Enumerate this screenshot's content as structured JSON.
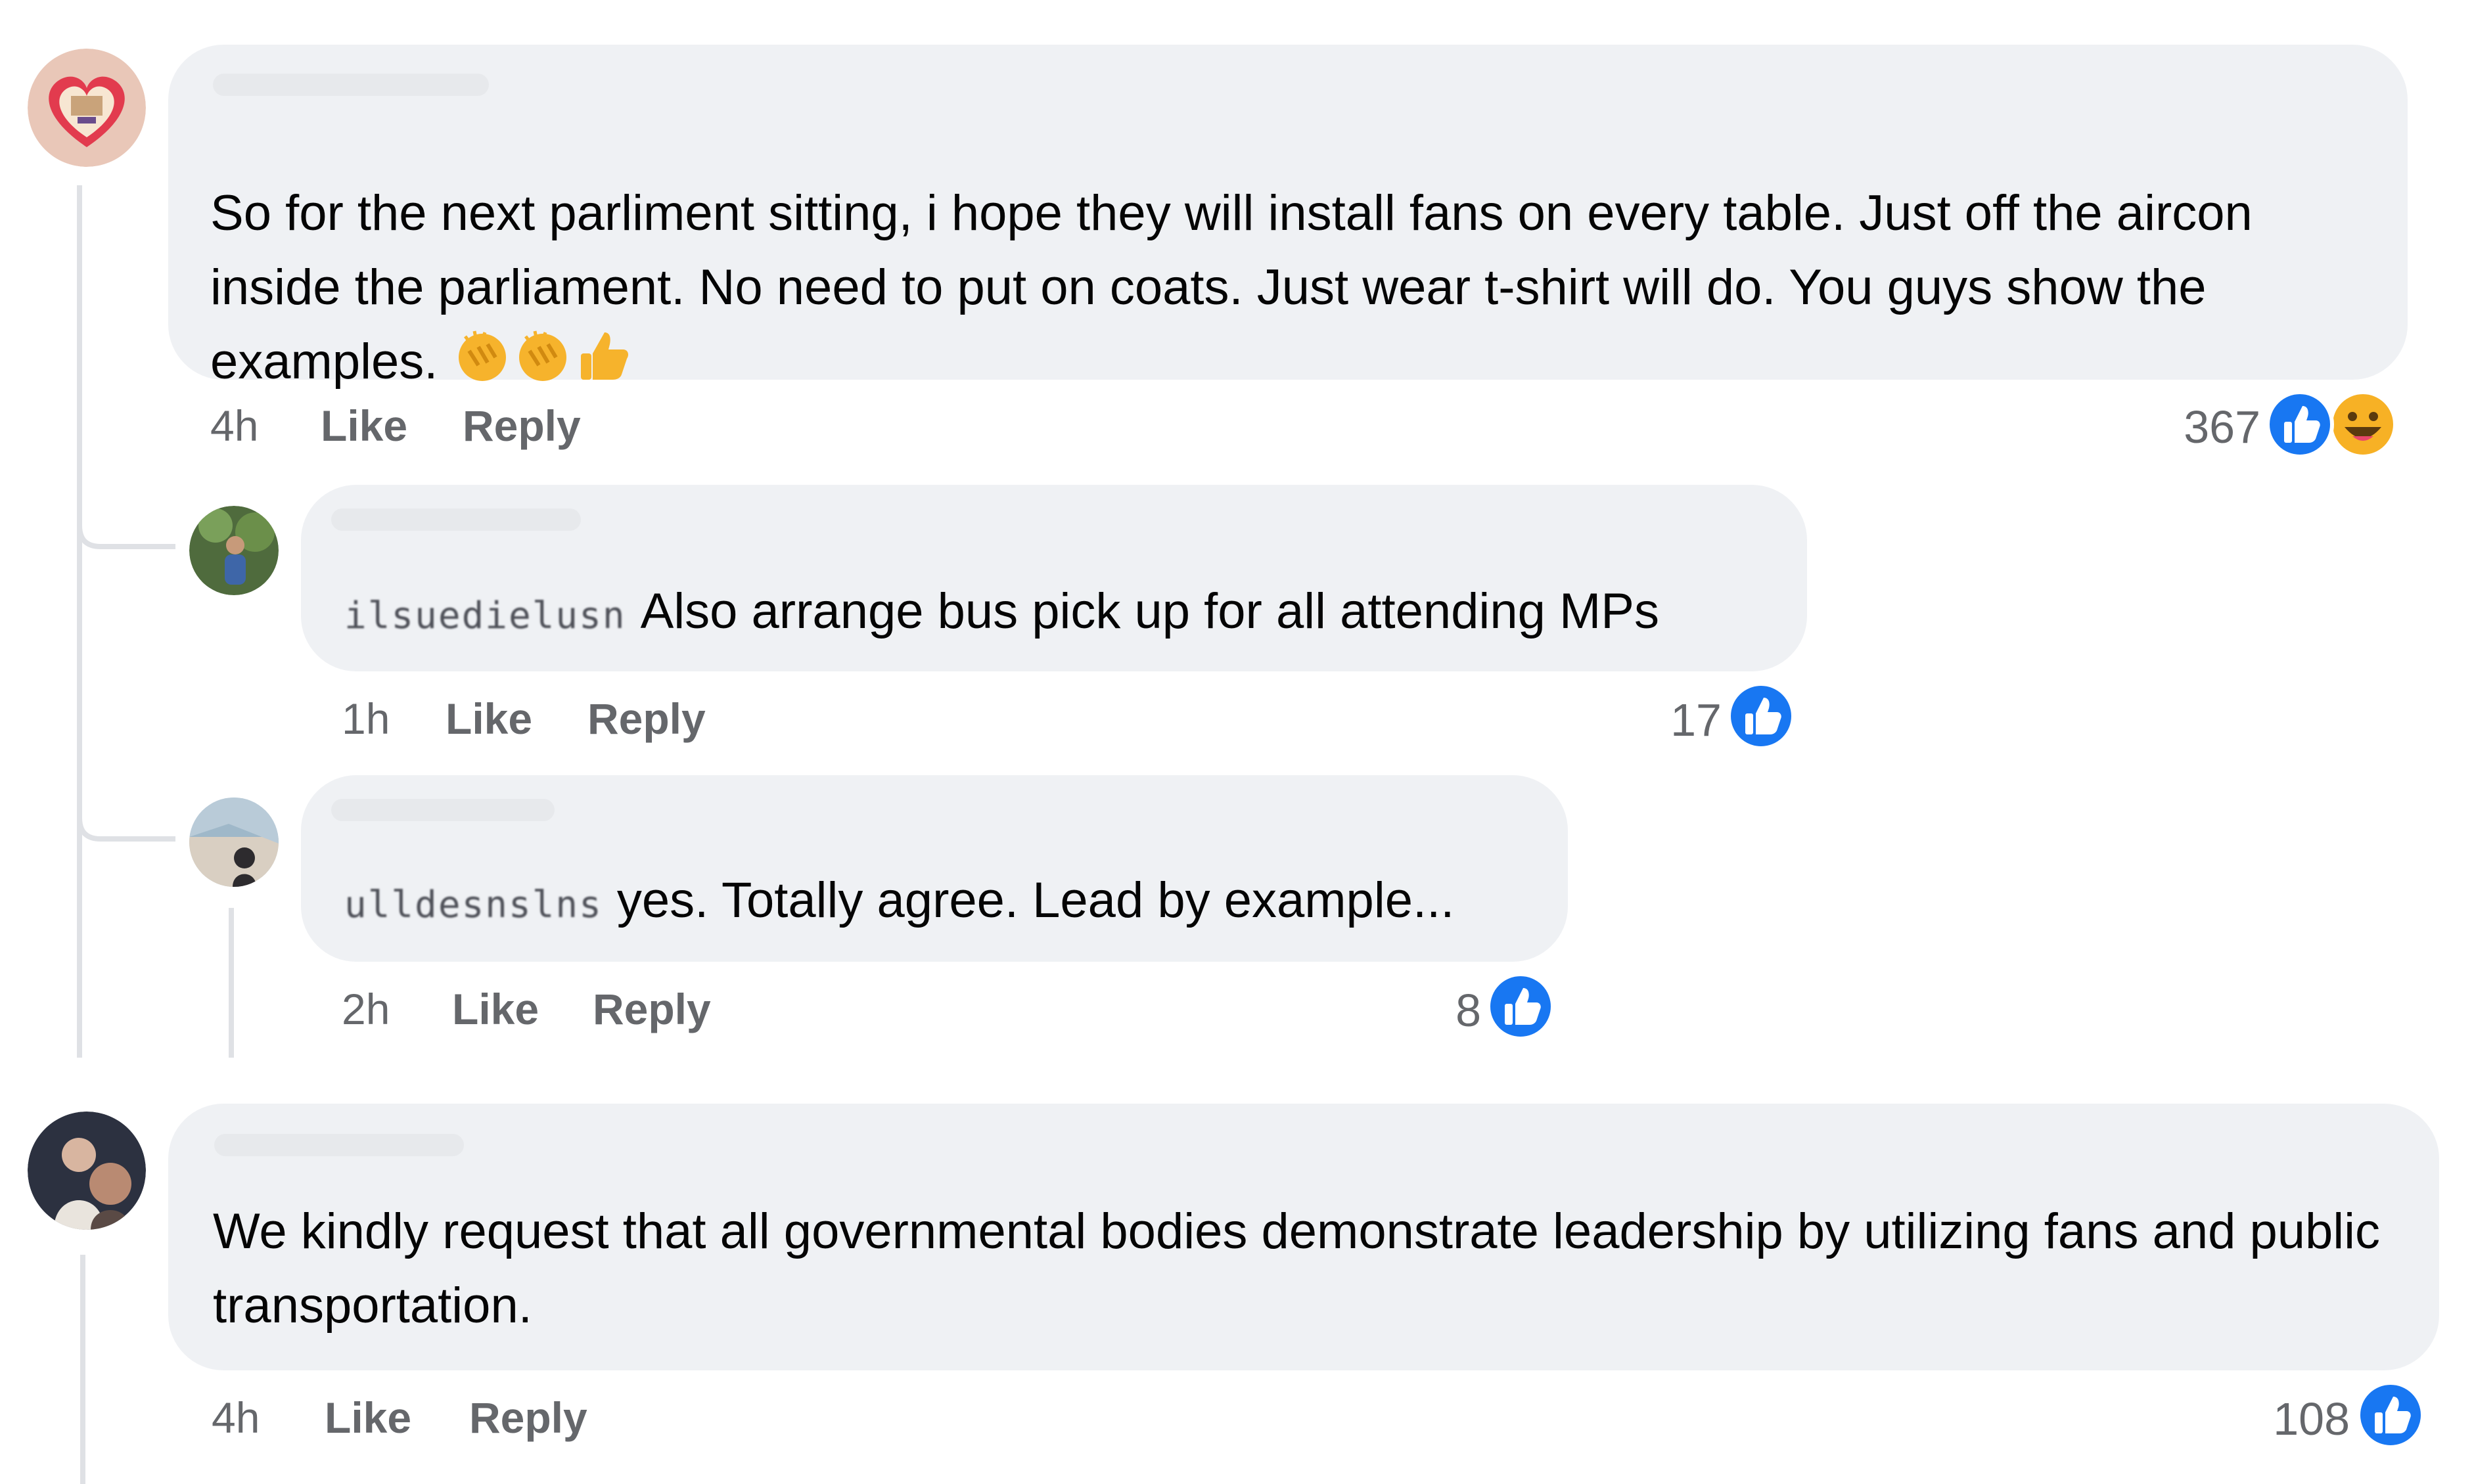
{
  "comments": [
    {
      "text": "So for the next parliment sitting, i hope they will install fans on every table. Just off the aircon inside the parliament. No need to put on coats. Just wear t-shirt will do. You guys show the examples.",
      "emojis": [
        "clapping-hands",
        "clapping-hands",
        "thumbs-up"
      ],
      "time": "4h",
      "like_label": "Like",
      "reply_label": "Reply",
      "reaction_count": "367",
      "reactions": [
        "like",
        "haha"
      ],
      "replies": [
        {
          "tag": "ilsuedielusn",
          "text": "Also arrange bus pick up for all attending MPs",
          "time": "1h",
          "like_label": "Like",
          "reply_label": "Reply",
          "reaction_count": "17",
          "reactions": [
            "like"
          ]
        },
        {
          "tag": "ulldesnslns",
          "text": "yes. Totally agree. Lead by example...",
          "time": "2h",
          "like_label": "Like",
          "reply_label": "Reply",
          "reaction_count": "8",
          "reactions": [
            "like"
          ]
        }
      ]
    },
    {
      "text": "We kindly request that all governmental bodies demonstrate leadership by utilizing fans and public transportation.",
      "time": "4h",
      "like_label": "Like",
      "reply_label": "Reply",
      "reaction_count": "108",
      "reactions": [
        "like"
      ]
    }
  ],
  "colors": {
    "bubble": "#eff1f4",
    "meta_text": "#65676b",
    "like_blue": "#1877f2",
    "haha_yellow": "#f7b125",
    "thread_line": "#dfe1e5"
  }
}
